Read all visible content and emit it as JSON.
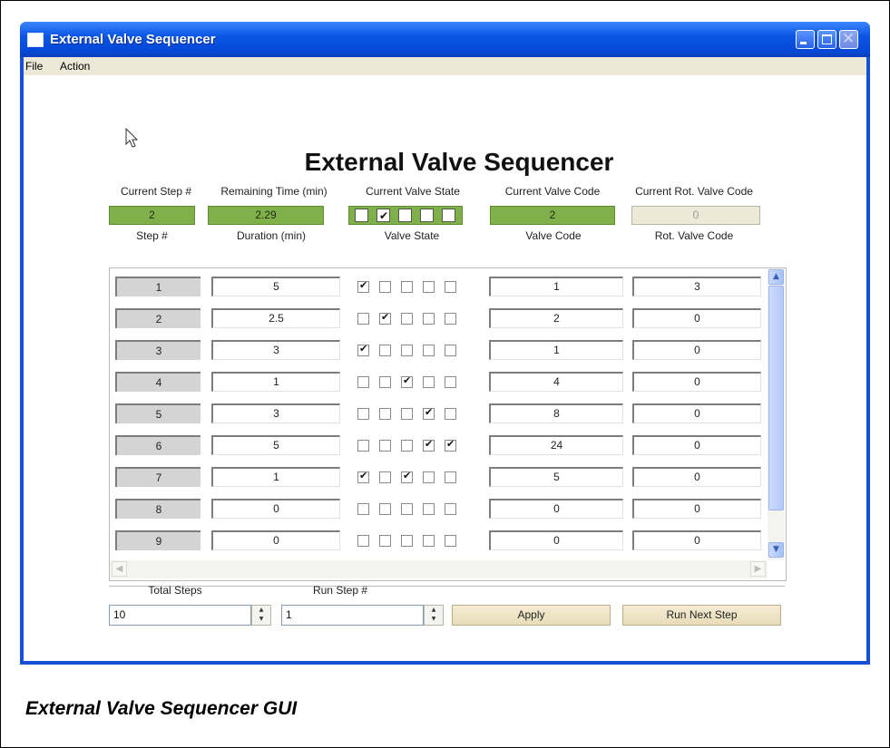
{
  "window": {
    "title": "External Valve Sequencer"
  },
  "menu": [
    {
      "label": "File"
    },
    {
      "label": "Action"
    }
  ],
  "heading": "External Valve Sequencer",
  "status": {
    "labels": {
      "current_step": "Current Step #",
      "remaining_time": "Remaining Time (min)",
      "current_valve_state": "Current Valve State",
      "current_valve_code": "Current Valve Code",
      "current_rot_valve_code": "Current Rot. Valve Code"
    },
    "values": {
      "current_step": "2",
      "remaining_time": "2.29",
      "current_valve_state": [
        false,
        true,
        false,
        false,
        false
      ],
      "current_valve_code": "2",
      "current_rot_valve_code": "0"
    }
  },
  "table": {
    "headers": [
      "Step #",
      "Duration (min)",
      "Valve State",
      "Valve Code",
      "Rot. Valve Code"
    ],
    "rows": [
      {
        "step": "1",
        "duration": "5",
        "valves": [
          true,
          false,
          false,
          false,
          false
        ],
        "valve_code": "1",
        "rot_code": "3"
      },
      {
        "step": "2",
        "duration": "2.5",
        "valves": [
          false,
          true,
          false,
          false,
          false
        ],
        "valve_code": "2",
        "rot_code": "0"
      },
      {
        "step": "3",
        "duration": "3",
        "valves": [
          true,
          false,
          false,
          false,
          false
        ],
        "valve_code": "1",
        "rot_code": "0"
      },
      {
        "step": "4",
        "duration": "1",
        "valves": [
          false,
          false,
          true,
          false,
          false
        ],
        "valve_code": "4",
        "rot_code": "0"
      },
      {
        "step": "5",
        "duration": "3",
        "valves": [
          false,
          false,
          false,
          true,
          false
        ],
        "valve_code": "8",
        "rot_code": "0"
      },
      {
        "step": "6",
        "duration": "5",
        "valves": [
          false,
          false,
          false,
          true,
          true
        ],
        "valve_code": "24",
        "rot_code": "0"
      },
      {
        "step": "7",
        "duration": "1",
        "valves": [
          true,
          false,
          true,
          false,
          false
        ],
        "valve_code": "5",
        "rot_code": "0"
      },
      {
        "step": "8",
        "duration": "0",
        "valves": [
          false,
          false,
          false,
          false,
          false
        ],
        "valve_code": "0",
        "rot_code": "0"
      },
      {
        "step": "9",
        "duration": "0",
        "valves": [
          false,
          false,
          false,
          false,
          false
        ],
        "valve_code": "0",
        "rot_code": "0"
      }
    ]
  },
  "controls": {
    "total_steps_label": "Total Steps",
    "total_steps_value": "10",
    "run_step_label": "Run Step #",
    "run_step_value": "1",
    "apply_label": "Apply",
    "run_next_label": "Run Next Step"
  },
  "caption": "External Valve Sequencer GUI",
  "colors": {
    "titlebar": "#0b56e4",
    "status_green": "#7fb049",
    "button_face": "#ece2c6"
  }
}
